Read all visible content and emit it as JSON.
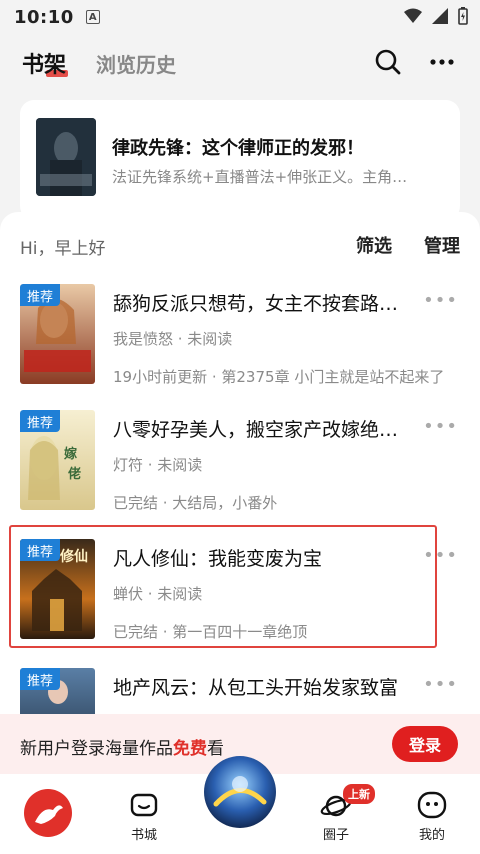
{
  "status_bar": {
    "time": "10:10",
    "notification_icon": "A"
  },
  "header": {
    "tab_shelf": "书架",
    "tab_history": "浏览历史",
    "search_icon": "search-icon",
    "more_icon": "more-icon"
  },
  "banner": {
    "title": "律政先锋：这个律师正的发邪！",
    "desc": "法证先锋系统+直播普法+伸张正义。主角…"
  },
  "shelf": {
    "greeting": "Hi，早上好",
    "filter": "筛选",
    "manage": "管理",
    "books": [
      {
        "tag": "推荐",
        "title": "舔狗反派只想苟，女主不按套路…",
        "author": "我是愤怒 · 未阅读",
        "status": "19小时前更新 · 第2375章 小门主就是站不起来了"
      },
      {
        "tag": "推荐",
        "title": "八零好孕美人，搬空家产改嫁绝…",
        "author": "灯符 · 未阅读",
        "status": "已完结 · 大结局，小番外"
      },
      {
        "tag": "推荐",
        "title": "凡人修仙：我能变废为宝",
        "author": "蝉伏 · 未阅读",
        "status": "已完结 · 第一百四十一章绝顶"
      },
      {
        "tag": "推荐",
        "title": "地产风云：从包工头开始发家致富",
        "author": "",
        "status": ""
      }
    ]
  },
  "login_bar": {
    "text_before": "新用户登录海量作品",
    "text_free": "免费",
    "text_after": "看",
    "button": "登录"
  },
  "tabbar": {
    "items": [
      {
        "label": ""
      },
      {
        "label": "书城"
      },
      {
        "label": ""
      },
      {
        "label": "圈子",
        "badge": "上新"
      },
      {
        "label": "我的"
      }
    ]
  },
  "colors": {
    "accent": "#e0302a",
    "tag": "#1f7fd6",
    "highlight": "#e0443e"
  }
}
